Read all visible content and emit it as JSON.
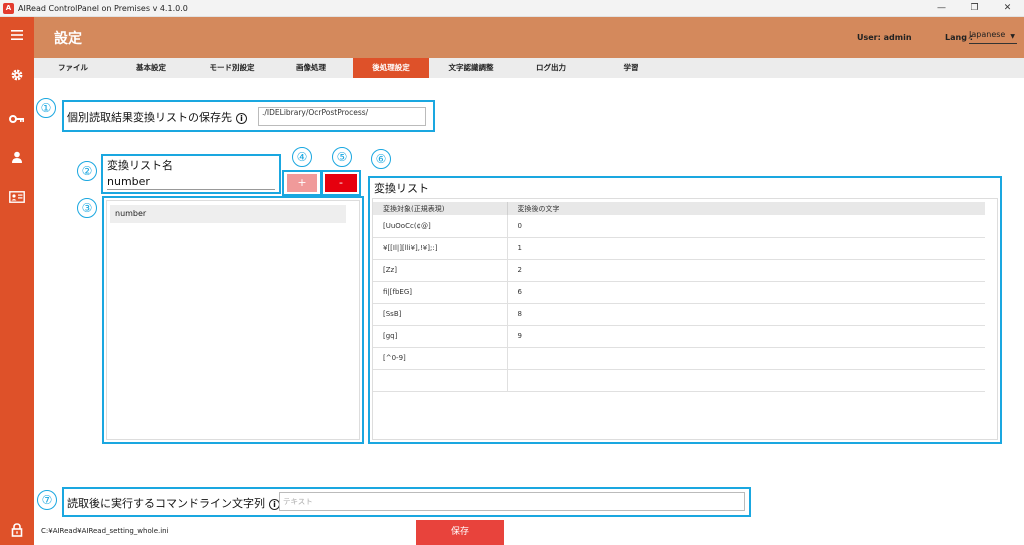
{
  "window": {
    "title": "AIRead ControlPanel on Premises v 4.1.0.0",
    "logo_text": "A",
    "controls": [
      "—",
      "❐",
      "✕"
    ]
  },
  "sidebar": {
    "icons": [
      "menu-icon",
      "gear-icon",
      "key-icon",
      "user-icon",
      "id-card-icon",
      "lock-icon"
    ]
  },
  "header": {
    "title": "設定",
    "user": "User: admin",
    "lang_label": "Lang :",
    "lang_value": "Japanese"
  },
  "tabs": [
    {
      "label": "ファイル",
      "active": false
    },
    {
      "label": "基本設定",
      "active": false
    },
    {
      "label": "モード別設定",
      "active": false
    },
    {
      "label": "画像処理",
      "active": false
    },
    {
      "label": "後処理設定",
      "active": true
    },
    {
      "label": "文字認識調整",
      "active": false
    },
    {
      "label": "ログ出力",
      "active": false
    },
    {
      "label": "学習",
      "active": false
    }
  ],
  "callout_numbers": [
    "①",
    "②",
    "③",
    "④",
    "⑤",
    "⑥",
    "⑦"
  ],
  "save_location": {
    "label": "個別読取結果変換リストの保存先",
    "value": "./IDELibrary/OcrPostProcess/"
  },
  "list_name": {
    "label": "変換リスト名",
    "value": "number"
  },
  "buttons": {
    "add": "+",
    "remove": "-",
    "save": "保存"
  },
  "list_items": [
    "number"
  ],
  "conversion": {
    "title": "変換リスト",
    "columns": [
      "変換対象(正規表現)",
      "変換後の文字"
    ],
    "rows": [
      [
        "[UuOoCc(¢@]",
        "0"
      ],
      [
        "¥[[Il|][lli¥],!¥];:]",
        "1"
      ],
      [
        "[Zz]",
        "2"
      ],
      [
        "fi|[fbEG]",
        "6"
      ],
      [
        "[SsB]",
        "8"
      ],
      [
        "[gq]",
        "9"
      ],
      [
        "[^0-9]",
        ""
      ],
      [
        "",
        ""
      ]
    ]
  },
  "command": {
    "label": "読取後に実行するコマンドライン文字列",
    "placeholder": "テキスト"
  },
  "footer": {
    "path": "C:¥AIRead¥AIRead_setting_whole.ini"
  }
}
